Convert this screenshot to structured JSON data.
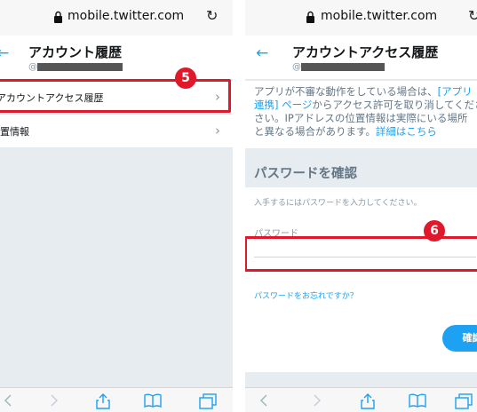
{
  "left": {
    "address": "mobile.twitter.com",
    "header": {
      "back": "←",
      "title": "アカウント履歴",
      "at": "@"
    },
    "items": [
      {
        "label": "アカウントアクセス履歴",
        "chevron": "›"
      },
      {
        "label": "位置情報",
        "chevron": "›"
      }
    ],
    "badge": "5"
  },
  "right": {
    "address": "mobile.twitter.com",
    "header": {
      "back": "←",
      "title": "アカウントアクセス履歴",
      "at": "@"
    },
    "desc": {
      "l1a": "アプリが不審な動作をしている場合は、",
      "l1b": "[アプリ",
      "l2a": "連携] ページ",
      "l2b": "からアクセス許可を取り消してください。",
      "l3": "さい。IPアドレスの位置情報は実際にいる場所",
      "l4a": "と異なる場合があります。",
      "l4b": "詳細はこちら"
    },
    "confirm_title": "パスワードを確認",
    "instruction": "入手するにはパスワードを入力してください。",
    "password_label": "パスワード",
    "password_value": "",
    "forgot": "パスワードをお忘れですか？",
    "confirm_button": "確認",
    "badge": "6"
  },
  "icons": {
    "lock": "lock-icon",
    "reload": "reload-icon",
    "share": "share-icon",
    "bookmarks": "bookmarks-icon",
    "tabs": "tabs-icon"
  },
  "colors": {
    "accent": "#1da1f2",
    "highlight": "#e0182a",
    "background": "#e6ecf0"
  }
}
